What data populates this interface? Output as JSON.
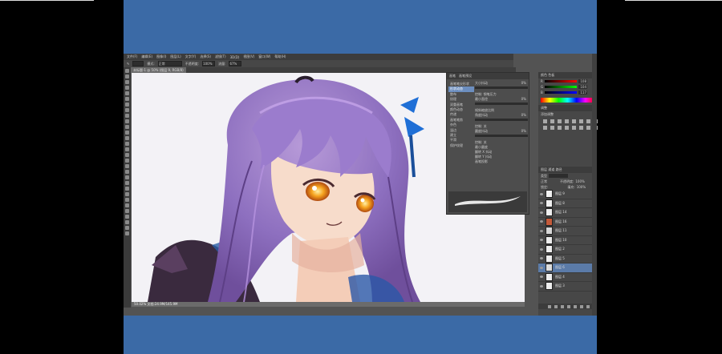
{
  "app": {
    "menu": [
      "文件(F)",
      "编辑(E)",
      "图像(I)",
      "图层(L)",
      "文字(Y)",
      "选择(S)",
      "滤镜(T)",
      "3D(D)",
      "视图(V)",
      "窗口(W)",
      "帮助(H)"
    ],
    "options": {
      "mode_label": "模式:",
      "mode_value": "正常",
      "opacity_label": "不透明度:",
      "opacity_value": "100%",
      "flow_label": "流量:",
      "flow_value": "67%"
    },
    "tabs": [
      "未标题-1 @ 50% (图层 9, RGB/8)"
    ],
    "status": "50.02%   文档:24.9M/145.9M"
  },
  "brush_panel": {
    "tabs": [
      "画笔",
      "画笔预设"
    ],
    "presets_button": "画笔预设",
    "list": [
      "画笔笔尖形状",
      "形状动态",
      "散布",
      "纹理",
      "双重画笔",
      "颜色动态",
      "传递",
      "画笔笔势",
      "杂色",
      "湿边",
      "建立",
      "平滑",
      "保护纹理"
    ],
    "settings": [
      {
        "label": "大小抖动",
        "value": "0%",
        "fill": 0
      },
      {
        "label": "控制: 钢笔压力",
        "value": "",
        "fill": 0
      },
      {
        "label": "最小直径",
        "value": "0%",
        "fill": 0
      },
      {
        "label": "倾斜缩放比例",
        "value": "",
        "fill": 0
      },
      {
        "label": "角度抖动",
        "value": "0%",
        "fill": 0
      },
      {
        "label": "控制: 关",
        "value": "",
        "fill": 0
      },
      {
        "label": "圆度抖动",
        "value": "0%",
        "fill": 0
      },
      {
        "label": "控制: 关",
        "value": "",
        "fill": 0
      },
      {
        "label": "最小圆度",
        "value": "",
        "fill": 0
      }
    ],
    "checkbox_1": "翻转 X 抖动",
    "checkbox_2": "翻转 Y 抖动",
    "checkbox_3": "画笔投影"
  },
  "color_panel": {
    "tabs": [
      "颜色",
      "色板"
    ],
    "r": "108",
    "g": "104",
    "b": "117",
    "adjust_tab": "调整",
    "adjust_title": "添加调整"
  },
  "layers_panel": {
    "tabs": [
      "图层",
      "通道",
      "路径"
    ],
    "kind_label": "类型",
    "blend_mode": "正常",
    "opacity_label": "不透明度:",
    "opacity": "100%",
    "lock_label": "锁定:",
    "fill_label": "填充:",
    "fill": "100%",
    "layers": [
      {
        "name": "图层 9",
        "thumb": "#f0f0f0",
        "selected": false
      },
      {
        "name": "图层 8",
        "thumb": "#f0f0f0",
        "selected": false
      },
      {
        "name": "图层 14",
        "thumb": "#efefef",
        "selected": false
      },
      {
        "name": "图层 16",
        "thumb": "#c45a3a",
        "selected": false
      },
      {
        "name": "图层 11",
        "thumb": "#d8d8d8",
        "selected": false
      },
      {
        "name": "图层 10",
        "thumb": "#eeeeee",
        "selected": false
      },
      {
        "name": "图层 2",
        "thumb": "#eeeeee",
        "selected": false
      },
      {
        "name": "图层 5",
        "thumb": "#eeeeee",
        "selected": false
      },
      {
        "name": "图层 6",
        "thumb": "#dddddd",
        "selected": true
      },
      {
        "name": "图层 4",
        "thumb": "#eeeeee",
        "selected": false
      },
      {
        "name": "图层 3",
        "thumb": "#eeeeee",
        "selected": false
      }
    ]
  },
  "colors": {
    "frame_bg": "#3b6aa6",
    "ui_bg": "#535353",
    "selection": "#5b7ba8"
  }
}
